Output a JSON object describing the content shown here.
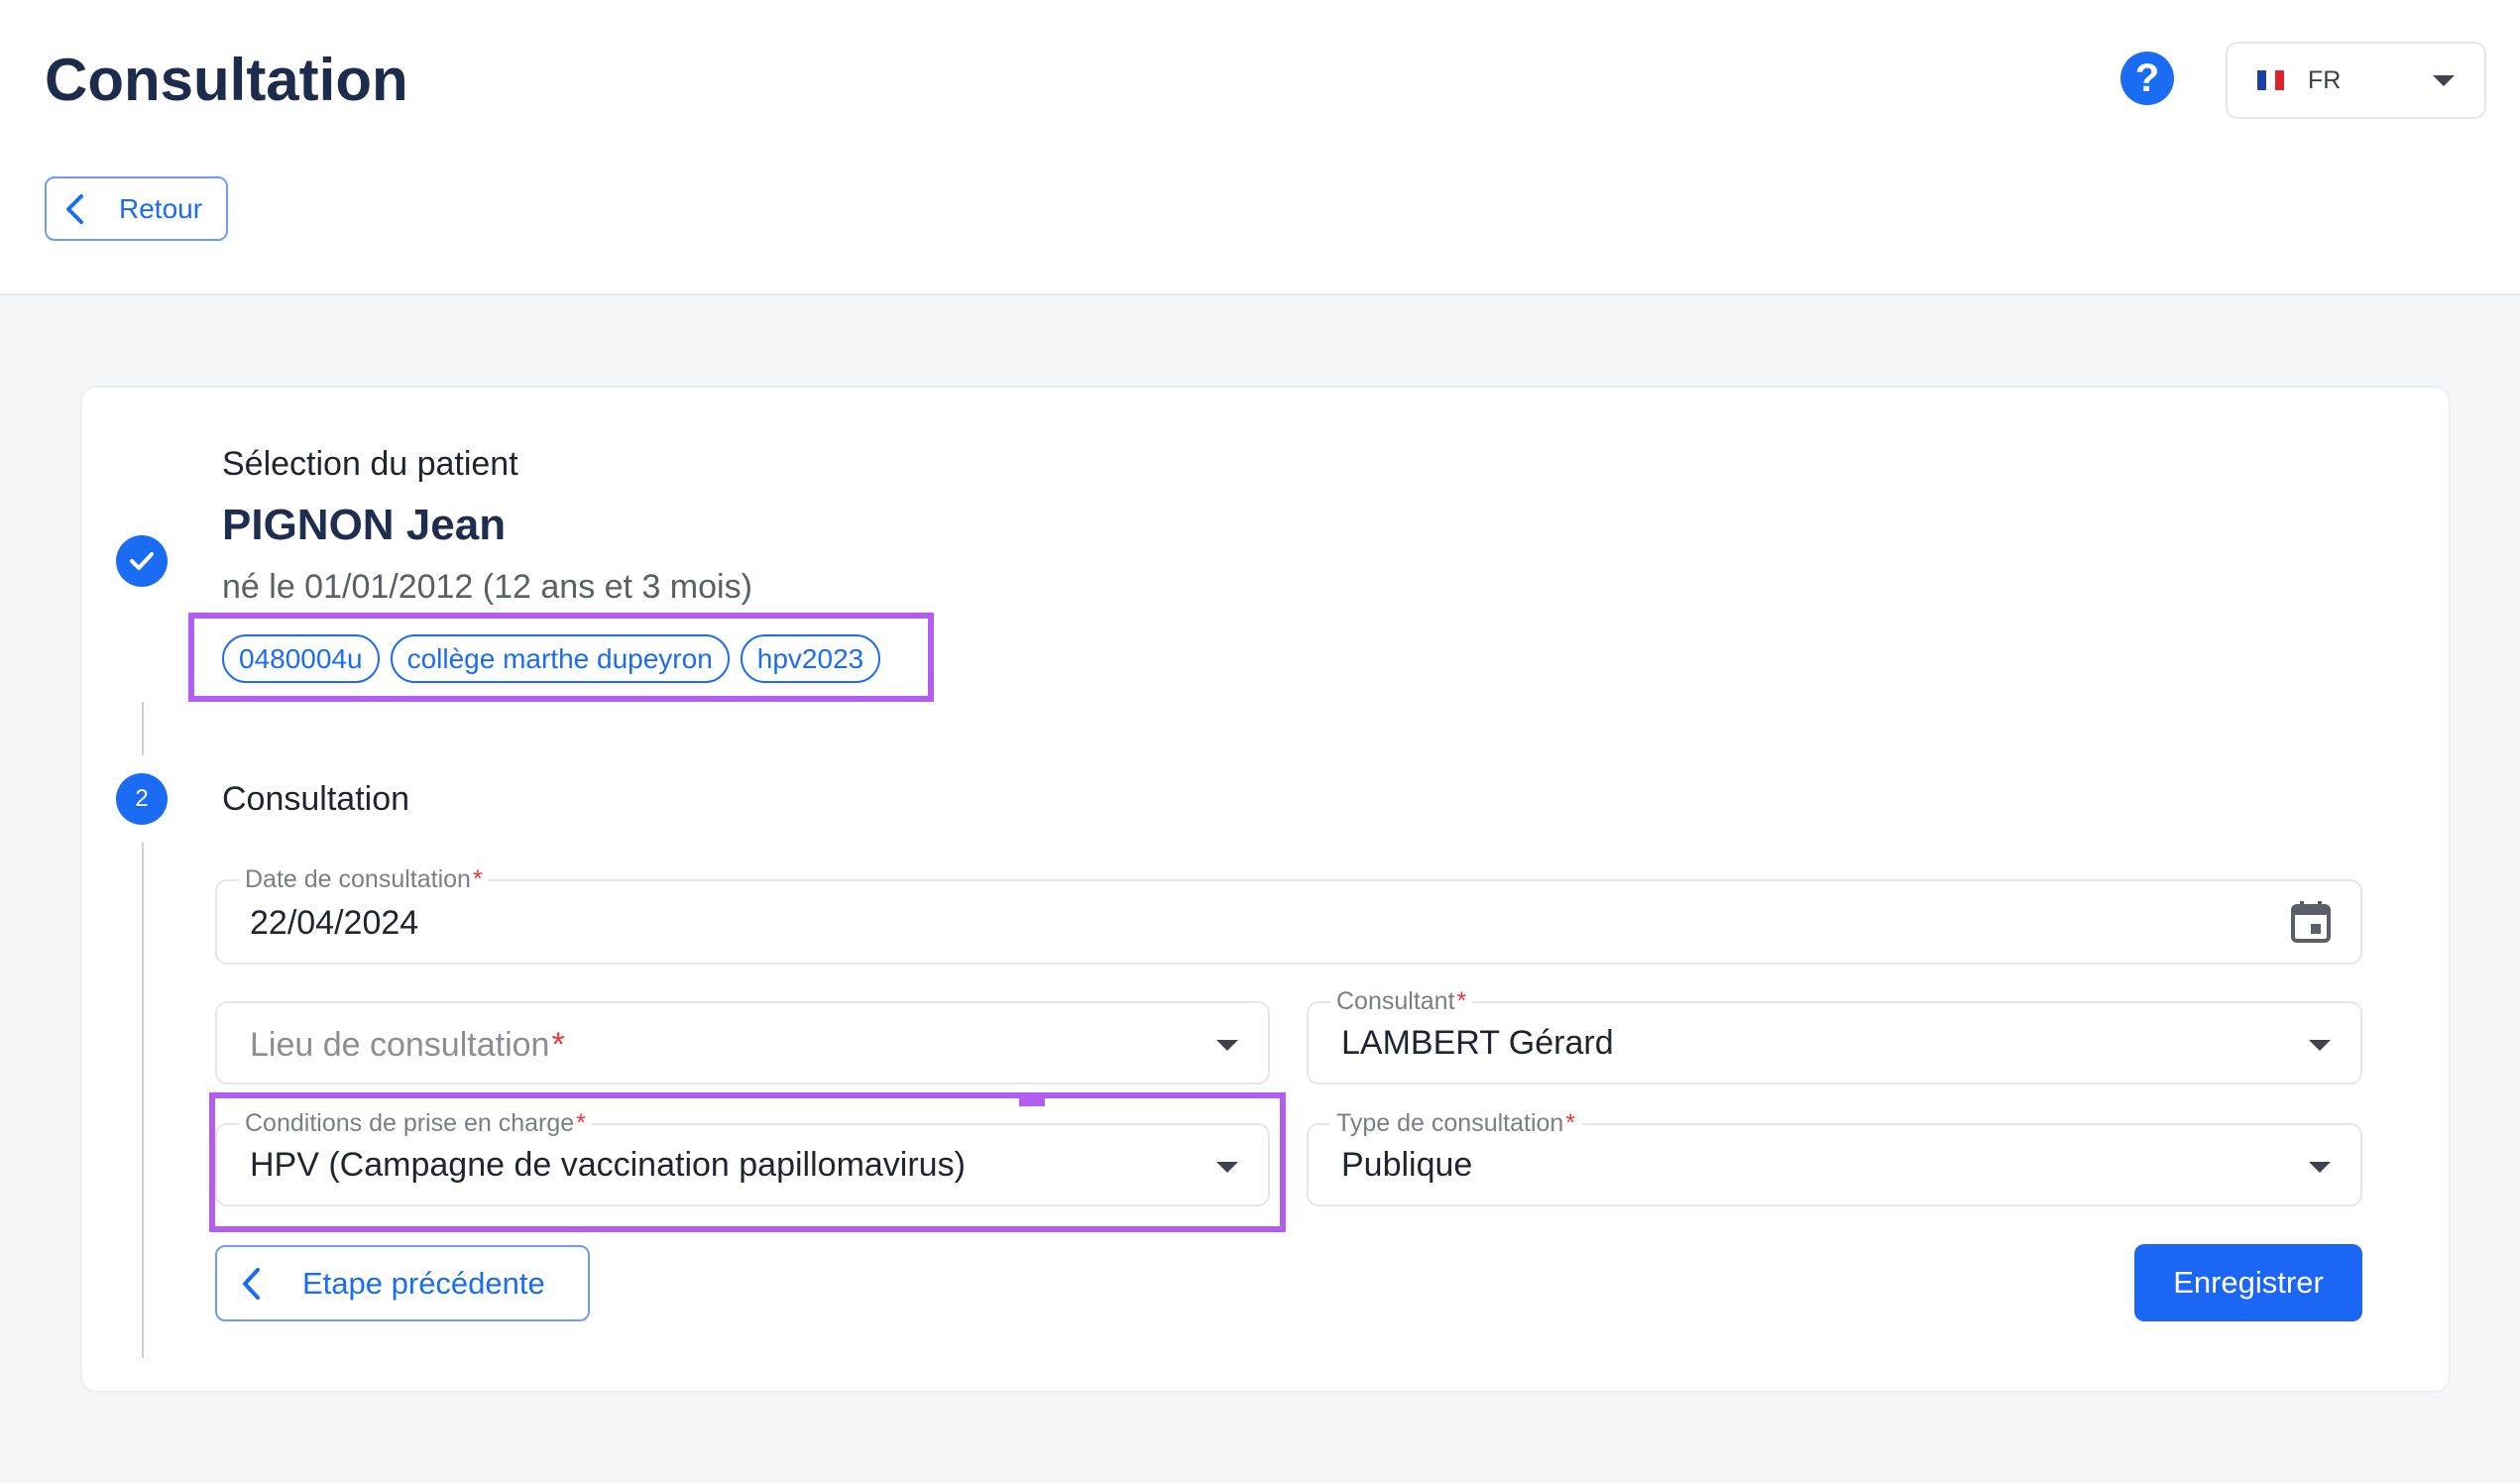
{
  "header": {
    "title": "Consultation",
    "help_icon": "help-circle-icon",
    "language": {
      "flag_icon": "france-flag-icon",
      "code": "FR"
    },
    "back_label": "Retour"
  },
  "steps": [
    {
      "state": "completed",
      "icon": "check-icon",
      "title": "Sélection du patient",
      "patient": {
        "name": "PIGNON Jean",
        "birth": "né le 01/01/2012 (12 ans et 3 mois)",
        "tags": [
          "0480004u",
          "collège marthe dupeyron",
          "hpv2023"
        ]
      }
    },
    {
      "state": "active",
      "number": "2",
      "title": "Consultation"
    }
  ],
  "form": {
    "date": {
      "label": "Date de consultation",
      "required_mark": "*",
      "value": "22/04/2024",
      "icon": "calendar-icon"
    },
    "lieu": {
      "placeholder": "Lieu de consultation",
      "required_mark": "*",
      "value": ""
    },
    "consultant": {
      "label": "Consultant",
      "required_mark": "*",
      "value": "LAMBERT Gérard"
    },
    "conditions": {
      "label": "Conditions de prise en charge",
      "required_mark": "*",
      "value": "HPV (Campagne de vaccination papillomavirus)"
    },
    "type": {
      "label": "Type de consultation",
      "required_mark": "*",
      "value": "Publique"
    }
  },
  "actions": {
    "previous_label": "Etape précédente",
    "save_label": "Enregistrer"
  },
  "colors": {
    "accent": "#1b6cf5",
    "highlight": "#b35ef0",
    "title": "#1d2b4c",
    "required": "#e53935"
  }
}
